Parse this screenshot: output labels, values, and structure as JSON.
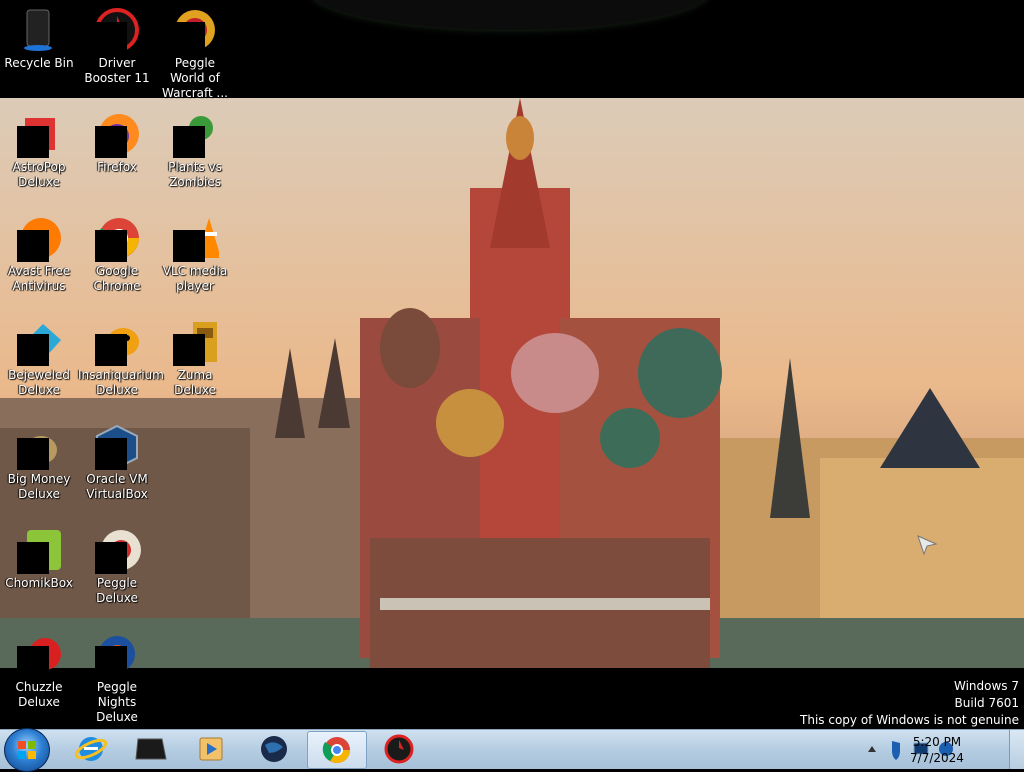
{
  "desktop": {
    "icons": [
      {
        "label": "Recycle Bin",
        "icon": "recycle-bin-icon"
      },
      {
        "label": "Driver Booster 11",
        "icon": "driver-booster-icon"
      },
      {
        "label": "Peggle World of Warcraft ...",
        "icon": "peggle-warcraft-icon"
      },
      {
        "label": "AstroPop Deluxe",
        "icon": "astropop-icon"
      },
      {
        "label": "Firefox",
        "icon": "firefox-icon"
      },
      {
        "label": "Plants vs Zombies",
        "icon": "plants-vs-zombies-icon"
      },
      {
        "label": "Avast Free Antivirus",
        "icon": "avast-icon"
      },
      {
        "label": "Google Chrome",
        "icon": "chrome-icon"
      },
      {
        "label": "VLC media player",
        "icon": "vlc-icon"
      },
      {
        "label": "Bejeweled Deluxe",
        "icon": "bejeweled-icon"
      },
      {
        "label": "Insaniquarium Deluxe",
        "icon": "insaniquarium-icon"
      },
      {
        "label": "Zuma Deluxe",
        "icon": "zuma-icon"
      },
      {
        "label": "Big Money Deluxe",
        "icon": "big-money-icon"
      },
      {
        "label": "Oracle VM VirtualBox",
        "icon": "virtualbox-icon"
      },
      {
        "label": "ChomikBox",
        "icon": "chomikbox-icon"
      },
      {
        "label": "Peggle Deluxe",
        "icon": "peggle-deluxe-icon"
      },
      {
        "label": "Chuzzle Deluxe",
        "icon": "chuzzle-icon"
      },
      {
        "label": "Peggle Nights Deluxe",
        "icon": "peggle-nights-icon"
      }
    ]
  },
  "watermark": {
    "line1": "Windows 7",
    "line2": "Build 7601",
    "line3": "This copy of Windows is not genuine"
  },
  "taskbar": {
    "pinned": [
      "internet-explorer-icon",
      "unknown-app-icon",
      "media-player-icon",
      "globe-icon",
      "chrome-icon",
      "driver-booster-icon"
    ],
    "active": "chrome-icon",
    "clock_time": "5:20 PM",
    "clock_date": "7/7/2024",
    "tray_icons": [
      "show-hidden-icons-chevron-icon",
      "security-shield-icon",
      "network-icon",
      "volume-icon"
    ]
  },
  "colors": {
    "taskbar_top": "#cfe0ef",
    "taskbar_bottom": "#a5c0d8",
    "watermark_text": "#ffffff"
  }
}
